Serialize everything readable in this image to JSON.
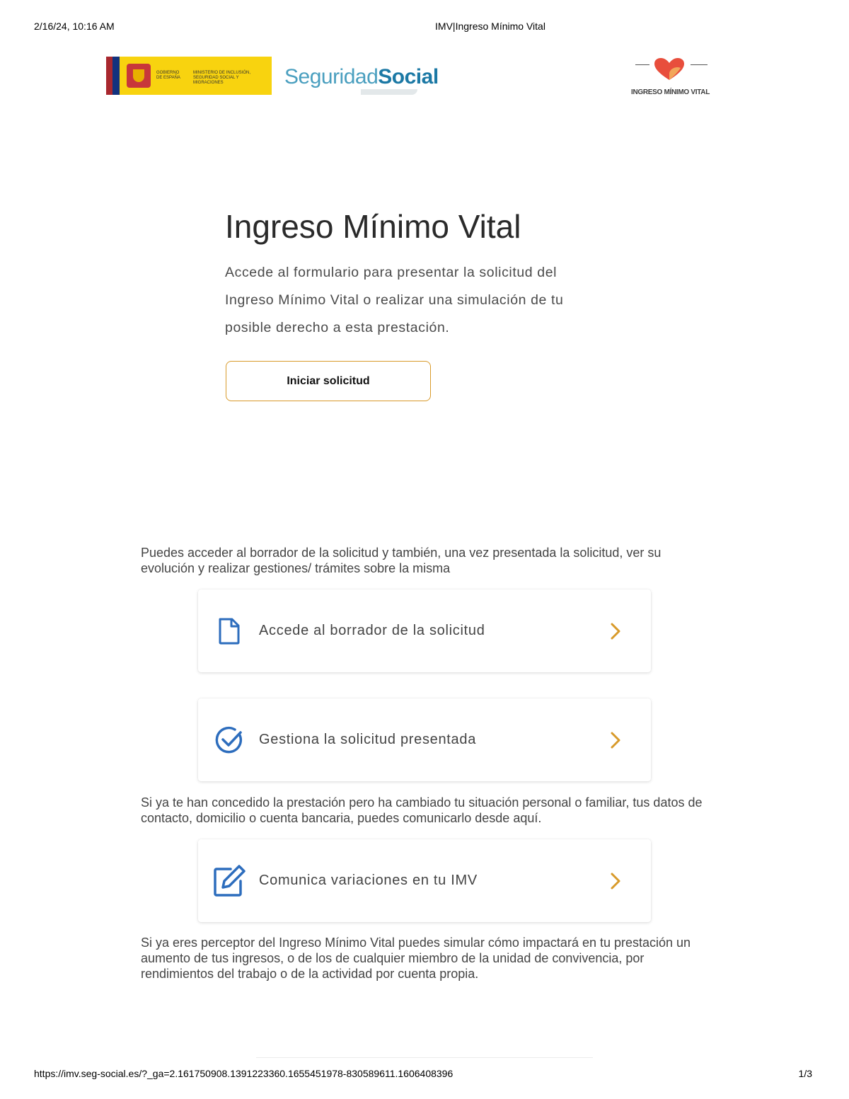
{
  "print_header": {
    "datetime": "2/16/24, 10:16 AM",
    "title": "IMV|Ingreso Mínimo Vital"
  },
  "print_footer": {
    "url": "https://imv.seg-social.es/?_ga=2.161750908.1391223360.1655451978-830589611.1606408396",
    "page": "1/3"
  },
  "logos": {
    "government": {
      "line1": "GOBIERNO DE ESPAÑA",
      "line2": "MINISTERIO DE INCLUSIÓN, SEGURIDAD SOCIAL Y MIGRACIONES"
    },
    "seguridad_social": {
      "part1": "Seguridad",
      "part2": "Social"
    },
    "imv_label": "INGRESO MÍNIMO VITAL"
  },
  "hero": {
    "title": "Ingreso Mínimo Vital",
    "description": "Accede al formulario para presentar la solicitud del Ingreso Mínimo Vital o realizar una simulación de tu posible derecho a esta prestación.",
    "start_button": "Iniciar solicitud"
  },
  "info": {
    "draft_intro": "Puedes acceder al borrador de la solicitud y también, una vez presentada la solicitud, ver su evolución y realizar gestiones/ trámites sobre la misma",
    "changes_intro": "Si ya te han concedido la prestación pero ha cambiado tu situación personal o familiar, tus datos de contacto, domicilio o cuenta bancaria, puedes comunicarlo desde aquí.",
    "simulation_intro": "Si ya eres perceptor del Ingreso Mínimo Vital puedes simular cómo impactará en tu prestación un aumento de tus ingresos, o de los de cualquier miembro de la unidad de convivencia, por rendimientos del trabajo o de la actividad por cuenta propia."
  },
  "cards": [
    {
      "label": "Accede al borrador de la solicitud",
      "icon": "document-icon"
    },
    {
      "label": "Gestiona la solicitud presentada",
      "icon": "check-circle-icon"
    },
    {
      "label": "Comunica variaciones en tu IMV",
      "icon": "edit-icon"
    }
  ],
  "colors": {
    "accent": "#d89a2a",
    "icon_blue": "#2d6dbd",
    "brand_blue": "#1c79a5",
    "heart": "#e84e3c"
  }
}
